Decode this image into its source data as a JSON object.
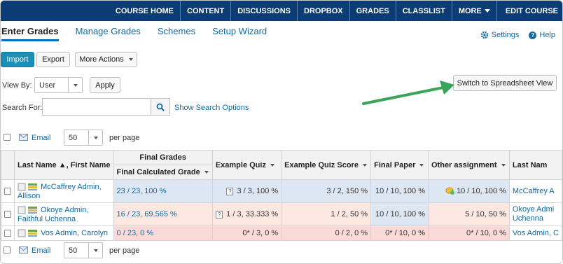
{
  "topnav": {
    "items": [
      "COURSE HOME",
      "CONTENT",
      "DISCUSSIONS",
      "DROPBOX",
      "GRADES",
      "CLASSLIST",
      "MORE",
      "EDIT COURSE"
    ]
  },
  "tabs": [
    "Enter Grades",
    "Manage Grades",
    "Schemes",
    "Setup Wizard"
  ],
  "tools": {
    "settings": "Settings",
    "help": "Help"
  },
  "toolbar": {
    "import": "Import",
    "export": "Export",
    "more_actions": "More Actions"
  },
  "view_by": {
    "label": "View By:",
    "value": "User",
    "apply": "Apply"
  },
  "switch_button": "Switch to Spreadsheet View",
  "search": {
    "label": "Search For:",
    "value": "",
    "show_options": "Show Search Options"
  },
  "paging": {
    "email": "Email",
    "per_page_value": "50",
    "per_page_label": "per page"
  },
  "table": {
    "group_header": "Final Grades",
    "headers": {
      "name": "Last Name ▲, First Name",
      "final_calc": "Final Calculated Grade",
      "quiz": "Example Quiz",
      "quiz_score": "Example Quiz Score",
      "final_paper": "Final Paper",
      "other": "Other assignment",
      "last_name": "Last Nam"
    },
    "rows": [
      {
        "name": "McCaffrey Admin, Allison",
        "final": "23 / 23, 100 %",
        "quiz": "3 / 3, 100 %",
        "quiz_score": "3 / 2, 150 %",
        "paper": "10 / 10, 100 %",
        "other": "10 / 10, 100 %",
        "last": "McCaffrey A"
      },
      {
        "name": "Okoye Admin, Faithful Uchenna",
        "final": "16 / 23, 69.565 %",
        "quiz": "1 / 3, 33.333 %",
        "quiz_score": "1 / 2, 50 %",
        "paper": "10 / 10, 100 %",
        "other": "5 / 10, 50 %",
        "last": "Okoye Admi Uchenna"
      },
      {
        "name": "Vos Admin, Carolyn",
        "final": "0 / 23, 0 %",
        "quiz": "0* / 3, 0 %",
        "quiz_score": "0 / 2, 0 %",
        "paper": "0* / 10, 0 %",
        "other": "0* / 10, 0 %",
        "last": "Vos Admin, C"
      }
    ]
  },
  "colors": {
    "nav": "#0c3c74",
    "link": "#106ba3",
    "primary": "#1a8fb8",
    "arrow": "#3aa55a"
  }
}
